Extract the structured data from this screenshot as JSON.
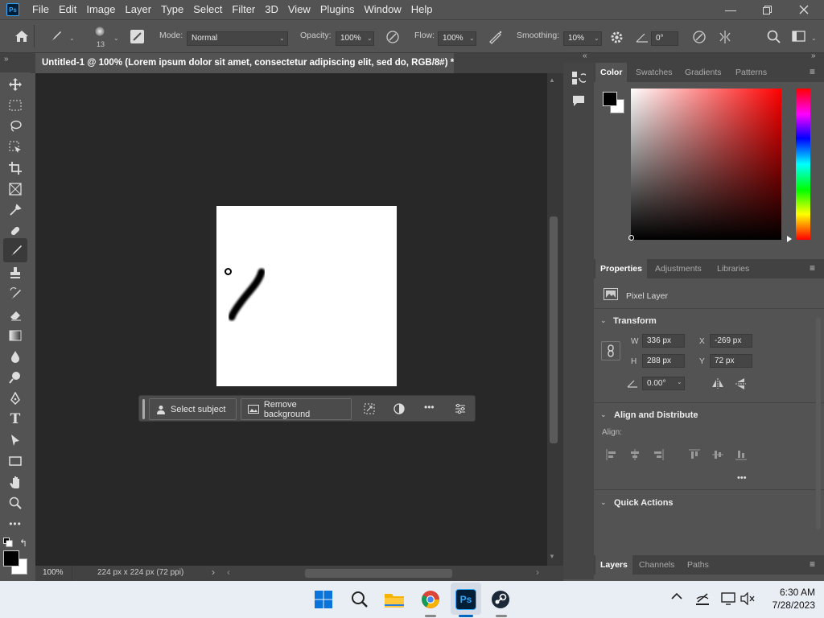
{
  "menubar": {
    "items": [
      "File",
      "Edit",
      "Image",
      "Layer",
      "Type",
      "Select",
      "Filter",
      "3D",
      "View",
      "Plugins",
      "Window",
      "Help"
    ],
    "logo": "Ps"
  },
  "options": {
    "brush_size": "13",
    "mode_label": "Mode:",
    "mode_value": "Normal",
    "opacity_label": "Opacity:",
    "opacity_value": "100%",
    "flow_label": "Flow:",
    "flow_value": "100%",
    "smoothing_label": "Smoothing:",
    "smoothing_value": "10%",
    "angle_value": "0°"
  },
  "document": {
    "tab_title": "Untitled-1 @ 100% (Lorem ipsum dolor sit amet, consectetur adipiscing elit, sed do, RGB/8#) *",
    "close": "×"
  },
  "context_bar": {
    "select_subject": "Select subject",
    "remove_background": "Remove background",
    "more": "•••"
  },
  "status": {
    "zoom": "100%",
    "doc_info": "224 px x 224 px (72 ppi)"
  },
  "color_panel": {
    "tabs": [
      "Color",
      "Swatches",
      "Gradients",
      "Patterns"
    ],
    "hue_color": "#ff0000",
    "foreground": "#000000",
    "background": "#ffffff"
  },
  "properties_panel": {
    "tabs": [
      "Properties",
      "Adjustments",
      "Libraries"
    ],
    "layer_type": "Pixel Layer",
    "transform_title": "Transform",
    "w_label": "W",
    "w_value": "336 px",
    "h_label": "H",
    "h_value": "288 px",
    "x_label": "X",
    "x_value": "-269 px",
    "y_label": "Y",
    "y_value": "72 px",
    "angle_value": "0.00°",
    "align_title": "Align and Distribute",
    "align_label": "Align:",
    "quick_actions_title": "Quick Actions",
    "more": "•••"
  },
  "layers_panel": {
    "tabs": [
      "Layers",
      "Channels",
      "Paths"
    ]
  },
  "taskbar": {
    "time": "6:30 AM",
    "date": "7/28/2023",
    "ps_label": "Ps"
  }
}
